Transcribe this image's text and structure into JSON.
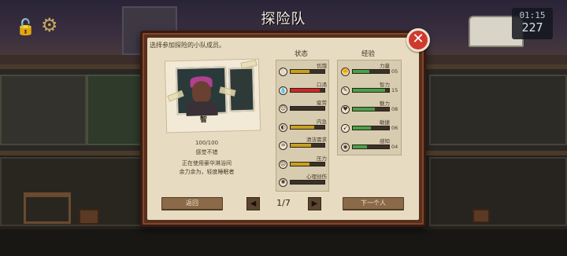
{
  "title": "探险队",
  "hud": {
    "time": "01:15",
    "counter": "227"
  },
  "instruction": "选择参加探险的小队成员。",
  "member": {
    "name": "智",
    "health": "100/100",
    "mood": "感觉不错",
    "activity": "正在使用豪华淋浴间",
    "status_note": "余力余为，轻度睡眠者"
  },
  "stats": {
    "header": "状态",
    "items": [
      {
        "label": "饥饿",
        "level": 0.55,
        "color": "#c8a020",
        "icon": "hunger-icon"
      },
      {
        "label": "口渴",
        "level": 0.85,
        "color": "#d02828",
        "icon": "thirst-icon"
      },
      {
        "label": "疲劳",
        "level": 0.0,
        "color": "#c8a020",
        "icon": "fatigue-icon"
      },
      {
        "label": "内急",
        "level": 0.7,
        "color": "#c8a020",
        "icon": "toilet-icon"
      },
      {
        "label": "清洁需求",
        "level": 0.6,
        "color": "#c8a020",
        "icon": "hygiene-icon"
      },
      {
        "label": "压力",
        "level": 0.55,
        "color": "#c8a020",
        "icon": "stress-icon"
      },
      {
        "label": "心理创伤",
        "level": 0.0,
        "color": "#c8a020",
        "icon": "trauma-icon"
      }
    ]
  },
  "experience": {
    "header": "经验",
    "items": [
      {
        "label": "力量",
        "value": "05",
        "level": 0.45,
        "icon": "strength-icon"
      },
      {
        "label": "智力",
        "value": "15",
        "level": 0.9,
        "icon": "intellect-icon"
      },
      {
        "label": "魅力",
        "value": "08",
        "level": 0.6,
        "icon": "charm-icon"
      },
      {
        "label": "敏捷",
        "value": "06",
        "level": 0.5,
        "icon": "agility-icon"
      },
      {
        "label": "感知",
        "value": "04",
        "level": 0.4,
        "icon": "perception-icon"
      }
    ],
    "bar_color": "#4aa048"
  },
  "footer": {
    "back_label": "返回",
    "page_indicator": "1/7",
    "next_label": "下一个人"
  }
}
